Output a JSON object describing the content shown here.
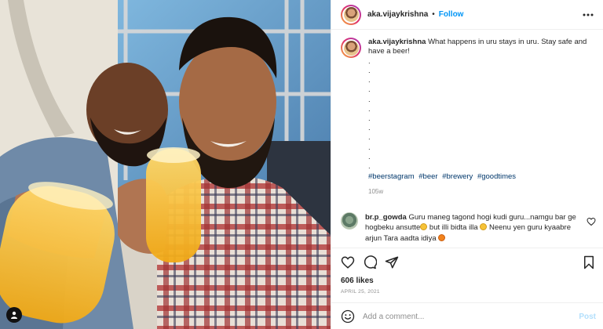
{
  "post": {
    "author": "aka.vijaykrishna",
    "separator": "•",
    "follow_label": "Follow",
    "caption": "What happens in uru stays in uru. Stay safe and have a beer!",
    "caption_dots": [
      ".",
      ".",
      ".",
      ".",
      ".",
      ".",
      ".",
      ".",
      ".",
      ".",
      ".",
      "."
    ],
    "hashtags": [
      "#beerstagram",
      "#beer",
      "#brewery",
      "#goodtimes"
    ],
    "caption_age": "105w",
    "likes": "606 likes",
    "date": "APRIL 25, 2021"
  },
  "comment": {
    "author": "br.p_gowda",
    "text_part1": "Guru maneg tagond hogi kudi guru...namgu bar ge hogbeku ansutte",
    "text_part2": " but illi bidta illa ",
    "text_part3": " Neenu yen guru kyaabre arjun Tara aadta idiya "
  },
  "add_comment": {
    "placeholder": "Add a comment...",
    "post_label": "Post"
  },
  "icons": {
    "more": "more-horizontal-icon",
    "heart": "heart-icon",
    "comment": "comment-icon",
    "share": "share-icon",
    "save": "bookmark-icon",
    "emoji": "smiley-icon",
    "user_tag": "person-icon"
  },
  "colors": {
    "accent": "#0095f6",
    "hashtag": "#00376b",
    "muted": "#8e8e8e",
    "post_disabled": "#b2dffc"
  }
}
